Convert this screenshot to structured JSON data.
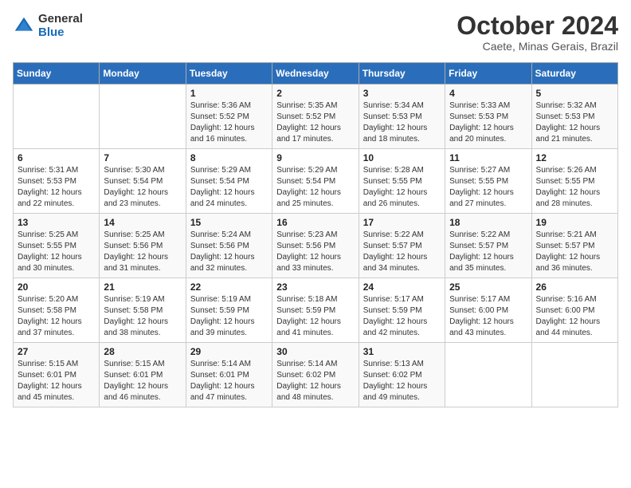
{
  "logo": {
    "general": "General",
    "blue": "Blue"
  },
  "title": "October 2024",
  "location": "Caete, Minas Gerais, Brazil",
  "days_of_week": [
    "Sunday",
    "Monday",
    "Tuesday",
    "Wednesday",
    "Thursday",
    "Friday",
    "Saturday"
  ],
  "weeks": [
    [
      {
        "day": "",
        "sunrise": "",
        "sunset": "",
        "daylight": ""
      },
      {
        "day": "",
        "sunrise": "",
        "sunset": "",
        "daylight": ""
      },
      {
        "day": "1",
        "sunrise": "Sunrise: 5:36 AM",
        "sunset": "Sunset: 5:52 PM",
        "daylight": "Daylight: 12 hours and 16 minutes."
      },
      {
        "day": "2",
        "sunrise": "Sunrise: 5:35 AM",
        "sunset": "Sunset: 5:52 PM",
        "daylight": "Daylight: 12 hours and 17 minutes."
      },
      {
        "day": "3",
        "sunrise": "Sunrise: 5:34 AM",
        "sunset": "Sunset: 5:53 PM",
        "daylight": "Daylight: 12 hours and 18 minutes."
      },
      {
        "day": "4",
        "sunrise": "Sunrise: 5:33 AM",
        "sunset": "Sunset: 5:53 PM",
        "daylight": "Daylight: 12 hours and 20 minutes."
      },
      {
        "day": "5",
        "sunrise": "Sunrise: 5:32 AM",
        "sunset": "Sunset: 5:53 PM",
        "daylight": "Daylight: 12 hours and 21 minutes."
      }
    ],
    [
      {
        "day": "6",
        "sunrise": "Sunrise: 5:31 AM",
        "sunset": "Sunset: 5:53 PM",
        "daylight": "Daylight: 12 hours and 22 minutes."
      },
      {
        "day": "7",
        "sunrise": "Sunrise: 5:30 AM",
        "sunset": "Sunset: 5:54 PM",
        "daylight": "Daylight: 12 hours and 23 minutes."
      },
      {
        "day": "8",
        "sunrise": "Sunrise: 5:29 AM",
        "sunset": "Sunset: 5:54 PM",
        "daylight": "Daylight: 12 hours and 24 minutes."
      },
      {
        "day": "9",
        "sunrise": "Sunrise: 5:29 AM",
        "sunset": "Sunset: 5:54 PM",
        "daylight": "Daylight: 12 hours and 25 minutes."
      },
      {
        "day": "10",
        "sunrise": "Sunrise: 5:28 AM",
        "sunset": "Sunset: 5:55 PM",
        "daylight": "Daylight: 12 hours and 26 minutes."
      },
      {
        "day": "11",
        "sunrise": "Sunrise: 5:27 AM",
        "sunset": "Sunset: 5:55 PM",
        "daylight": "Daylight: 12 hours and 27 minutes."
      },
      {
        "day": "12",
        "sunrise": "Sunrise: 5:26 AM",
        "sunset": "Sunset: 5:55 PM",
        "daylight": "Daylight: 12 hours and 28 minutes."
      }
    ],
    [
      {
        "day": "13",
        "sunrise": "Sunrise: 5:25 AM",
        "sunset": "Sunset: 5:55 PM",
        "daylight": "Daylight: 12 hours and 30 minutes."
      },
      {
        "day": "14",
        "sunrise": "Sunrise: 5:25 AM",
        "sunset": "Sunset: 5:56 PM",
        "daylight": "Daylight: 12 hours and 31 minutes."
      },
      {
        "day": "15",
        "sunrise": "Sunrise: 5:24 AM",
        "sunset": "Sunset: 5:56 PM",
        "daylight": "Daylight: 12 hours and 32 minutes."
      },
      {
        "day": "16",
        "sunrise": "Sunrise: 5:23 AM",
        "sunset": "Sunset: 5:56 PM",
        "daylight": "Daylight: 12 hours and 33 minutes."
      },
      {
        "day": "17",
        "sunrise": "Sunrise: 5:22 AM",
        "sunset": "Sunset: 5:57 PM",
        "daylight": "Daylight: 12 hours and 34 minutes."
      },
      {
        "day": "18",
        "sunrise": "Sunrise: 5:22 AM",
        "sunset": "Sunset: 5:57 PM",
        "daylight": "Daylight: 12 hours and 35 minutes."
      },
      {
        "day": "19",
        "sunrise": "Sunrise: 5:21 AM",
        "sunset": "Sunset: 5:57 PM",
        "daylight": "Daylight: 12 hours and 36 minutes."
      }
    ],
    [
      {
        "day": "20",
        "sunrise": "Sunrise: 5:20 AM",
        "sunset": "Sunset: 5:58 PM",
        "daylight": "Daylight: 12 hours and 37 minutes."
      },
      {
        "day": "21",
        "sunrise": "Sunrise: 5:19 AM",
        "sunset": "Sunset: 5:58 PM",
        "daylight": "Daylight: 12 hours and 38 minutes."
      },
      {
        "day": "22",
        "sunrise": "Sunrise: 5:19 AM",
        "sunset": "Sunset: 5:59 PM",
        "daylight": "Daylight: 12 hours and 39 minutes."
      },
      {
        "day": "23",
        "sunrise": "Sunrise: 5:18 AM",
        "sunset": "Sunset: 5:59 PM",
        "daylight": "Daylight: 12 hours and 41 minutes."
      },
      {
        "day": "24",
        "sunrise": "Sunrise: 5:17 AM",
        "sunset": "Sunset: 5:59 PM",
        "daylight": "Daylight: 12 hours and 42 minutes."
      },
      {
        "day": "25",
        "sunrise": "Sunrise: 5:17 AM",
        "sunset": "Sunset: 6:00 PM",
        "daylight": "Daylight: 12 hours and 43 minutes."
      },
      {
        "day": "26",
        "sunrise": "Sunrise: 5:16 AM",
        "sunset": "Sunset: 6:00 PM",
        "daylight": "Daylight: 12 hours and 44 minutes."
      }
    ],
    [
      {
        "day": "27",
        "sunrise": "Sunrise: 5:15 AM",
        "sunset": "Sunset: 6:01 PM",
        "daylight": "Daylight: 12 hours and 45 minutes."
      },
      {
        "day": "28",
        "sunrise": "Sunrise: 5:15 AM",
        "sunset": "Sunset: 6:01 PM",
        "daylight": "Daylight: 12 hours and 46 minutes."
      },
      {
        "day": "29",
        "sunrise": "Sunrise: 5:14 AM",
        "sunset": "Sunset: 6:01 PM",
        "daylight": "Daylight: 12 hours and 47 minutes."
      },
      {
        "day": "30",
        "sunrise": "Sunrise: 5:14 AM",
        "sunset": "Sunset: 6:02 PM",
        "daylight": "Daylight: 12 hours and 48 minutes."
      },
      {
        "day": "31",
        "sunrise": "Sunrise: 5:13 AM",
        "sunset": "Sunset: 6:02 PM",
        "daylight": "Daylight: 12 hours and 49 minutes."
      },
      {
        "day": "",
        "sunrise": "",
        "sunset": "",
        "daylight": ""
      },
      {
        "day": "",
        "sunrise": "",
        "sunset": "",
        "daylight": ""
      }
    ]
  ]
}
